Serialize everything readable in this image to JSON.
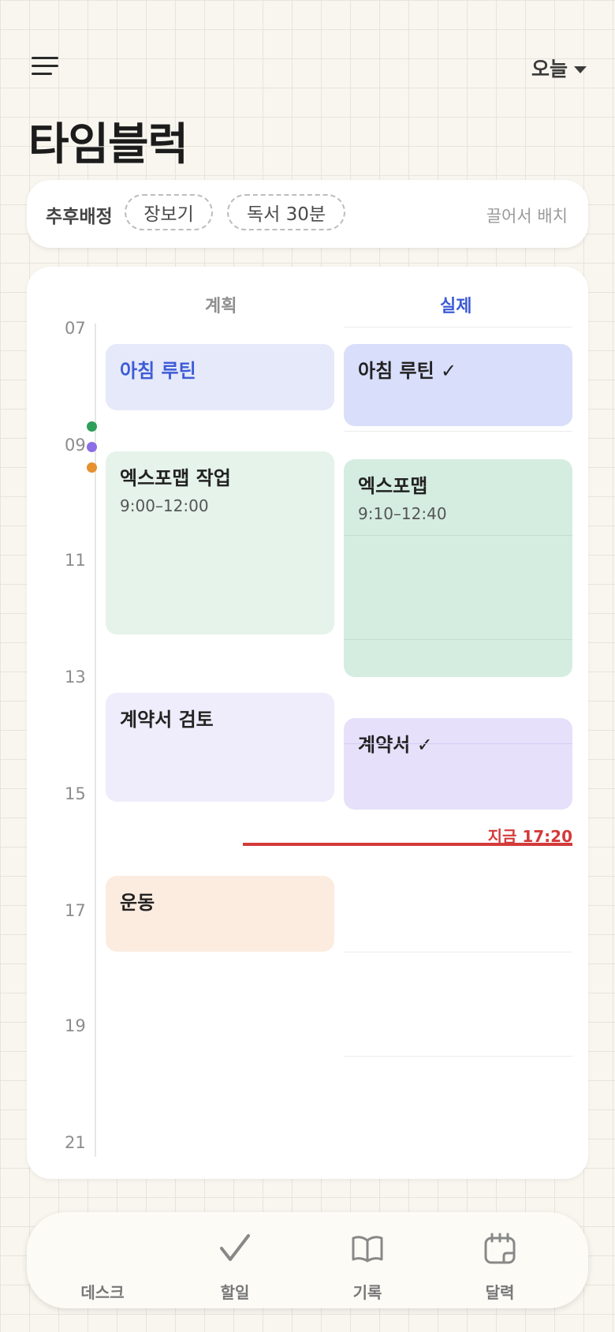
{
  "header": {
    "title": "타임블럭",
    "date_selector": "오늘"
  },
  "backlog": {
    "label": "추후배정",
    "chips": [
      "장보기",
      "독서 30분"
    ],
    "hint": "끌어서 배치"
  },
  "timeline": {
    "columns": {
      "plan": "계획",
      "actual": "실제"
    },
    "hours": [
      "07",
      "09",
      "11",
      "13",
      "15",
      "17",
      "19",
      "21"
    ],
    "plan_blocks": [
      {
        "title": "아침 루틴",
        "time": ""
      },
      {
        "title": "엑스포맵 작업",
        "time": "9:00–12:00"
      },
      {
        "title": "계약서 검토",
        "time": ""
      },
      {
        "title": "운동",
        "time": ""
      }
    ],
    "actual_blocks": [
      {
        "title": "아침 루틴 ✓",
        "time": ""
      },
      {
        "title": "엑스포맵",
        "time": "9:10–12:40"
      },
      {
        "title": "계약서 ✓",
        "time": ""
      }
    ],
    "now_label": "지금 17:20",
    "colors": {
      "accent": "#3d5bd6",
      "now": "#d33a3a",
      "plan_blue": "#e6e9fa",
      "actual_blue": "#d9defa",
      "plan_green": "#e5f3ea",
      "actual_green": "#d5ede1",
      "plan_purple": "#efecfb",
      "actual_purple": "#e6e0fa",
      "plan_orange": "#fcece0",
      "dots": [
        "#2e9e5b",
        "#8b6ee6",
        "#e6902e"
      ]
    }
  },
  "bottom_nav": {
    "items": [
      {
        "label": "데스크",
        "icon": "desk-icon"
      },
      {
        "label": "할일",
        "icon": "checkmark-icon"
      },
      {
        "label": "기록",
        "icon": "book-icon"
      },
      {
        "label": "달력",
        "icon": "calendar-icon"
      }
    ]
  }
}
